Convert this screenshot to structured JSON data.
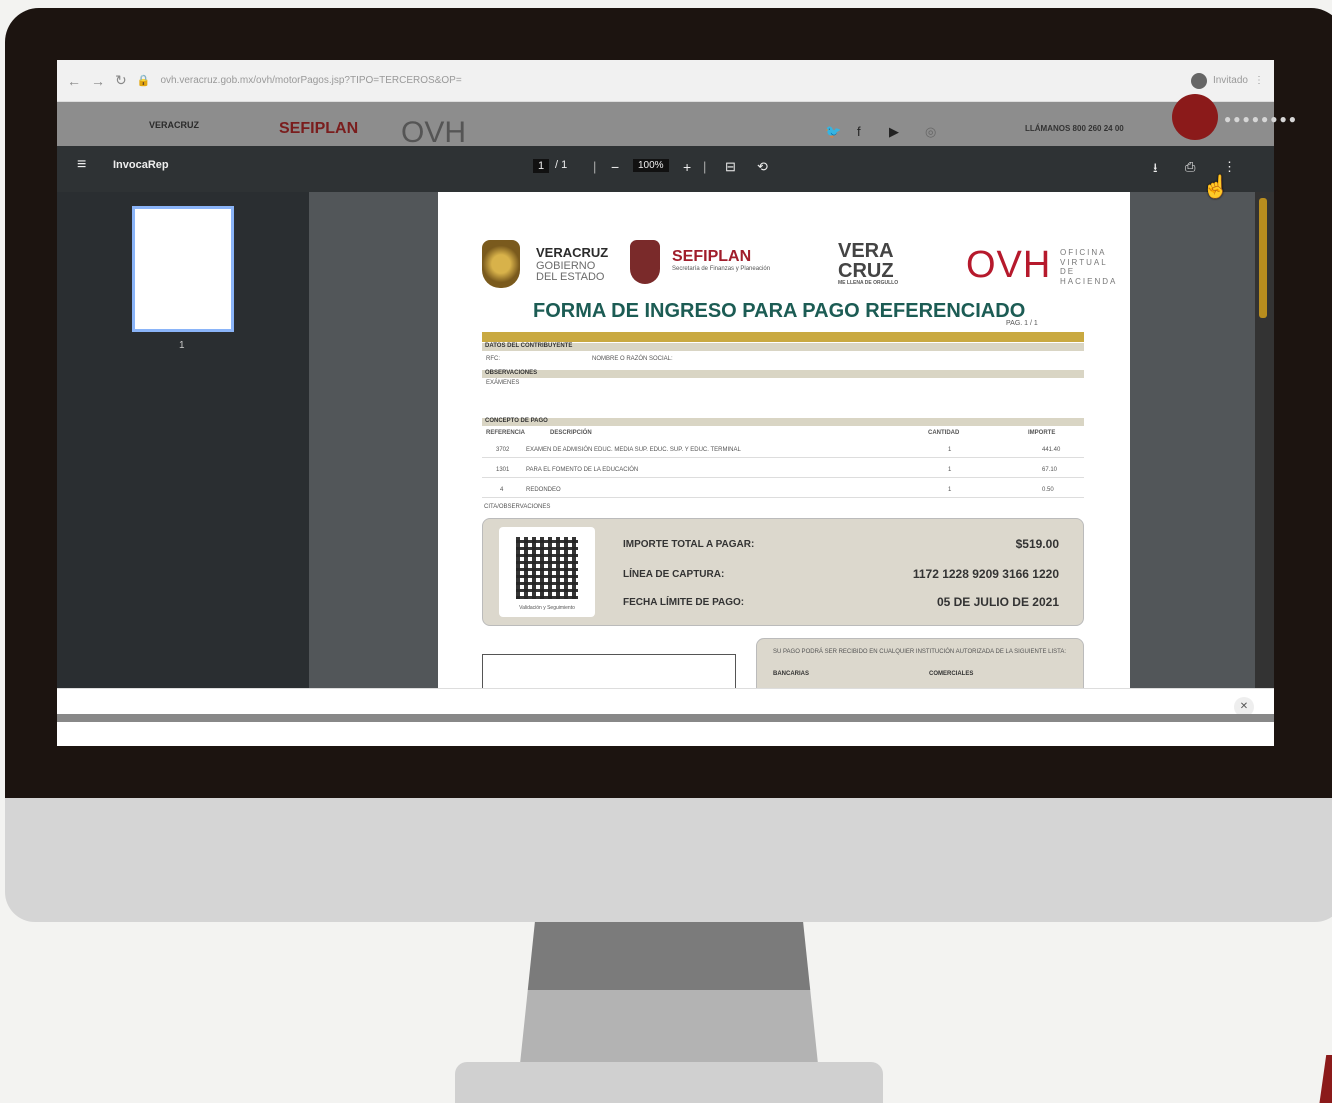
{
  "browser": {
    "url": "ovh.veracruz.gob.mx/ovh/motorPagos.jsp?TIPO=TERCEROS&OP=",
    "profile_label": "Invitado"
  },
  "site_header": {
    "logo_veracruz": "VERACRUZ",
    "logo_sefiplan": "SEFIPLAN",
    "logo_ovh": "OVH",
    "contact_text": "LLÁMANOS 800 260 24 00"
  },
  "pdf_viewer": {
    "document_title": "InvocaRep",
    "page_current": "1",
    "page_total": "/ 1",
    "zoom": "100%",
    "thumbnail_page_number": "1"
  },
  "document": {
    "veracruz_line1": "VERACRUZ",
    "veracruz_line2": "GOBIERNO",
    "veracruz_line3": "DEL ESTADO",
    "sefiplan": "SEFIPLAN",
    "sefiplan_sub": "Secretaría de Finanzas y Planeación",
    "vera_cruz_1": "VERA",
    "vera_cruz_2": "CRUZ",
    "vera_sub": "ME LLENA DE ORGULLO",
    "ovh": "OVH",
    "ovh_sub_1": "OFICINA",
    "ovh_sub_2": "VIRTUAL DE",
    "ovh_sub_3": "HACIENDA",
    "title": "FORMA DE INGRESO PARA PAGO REFERENCIADO",
    "page_label": "PAG. 1 / 1",
    "section_contribuyente": "DATOS DEL CONTRIBUYENTE",
    "rfc_label": "RFC:",
    "nombre_label": "NOMBRE O RAZÓN SOCIAL:",
    "section_observaciones": "OBSERVACIONES",
    "observaciones_value": "EXÁMENES",
    "section_concepto": "CONCEPTO DE PAGO",
    "col_referencia": "REFERENCIA",
    "col_descripcion": "DESCRIPCIÓN",
    "col_cantidad": "CANTIDAD",
    "col_importe": "IMPORTE",
    "rows": [
      {
        "ref": "3702",
        "desc": "EXAMEN DE ADMISIÓN EDUC. MEDIA SUP. EDUC. SUP. Y EDUC. TERMINAL",
        "qty": "1",
        "amount": "441.40"
      },
      {
        "ref": "1301",
        "desc": "PARA EL FOMENTO DE LA EDUCACIÓN",
        "qty": "1",
        "amount": "67.10"
      },
      {
        "ref": "4",
        "desc": "REDONDEO",
        "qty": "1",
        "amount": "0.50"
      }
    ],
    "footer_note": "CITA/OBSERVACIONES",
    "qr_caption": "Validación y Seguimiento",
    "importe_total_label": "IMPORTE TOTAL A PAGAR:",
    "importe_total_value": "$519.00",
    "linea_captura_label": "LÍNEA DE CAPTURA:",
    "linea_captura_value": "1172 1228 9209 3166 1220",
    "fecha_limite_label": "FECHA LÍMITE DE PAGO:",
    "fecha_limite_value": "05 DE JULIO DE 2021",
    "bank_note": "SU PAGO PODRÁ SER RECIBIDO EN CUALQUIER INSTITUCIÓN AUTORIZADA DE LA SIGUIENTE LISTA:",
    "bank_col1": "BANCARIAS",
    "bank_col2": "COMERCIALES"
  },
  "colors": {
    "bezel": "#1c1410",
    "accent_red": "#8b1a1a",
    "gold": "#c9a941",
    "title_green": "#1c5c54"
  }
}
